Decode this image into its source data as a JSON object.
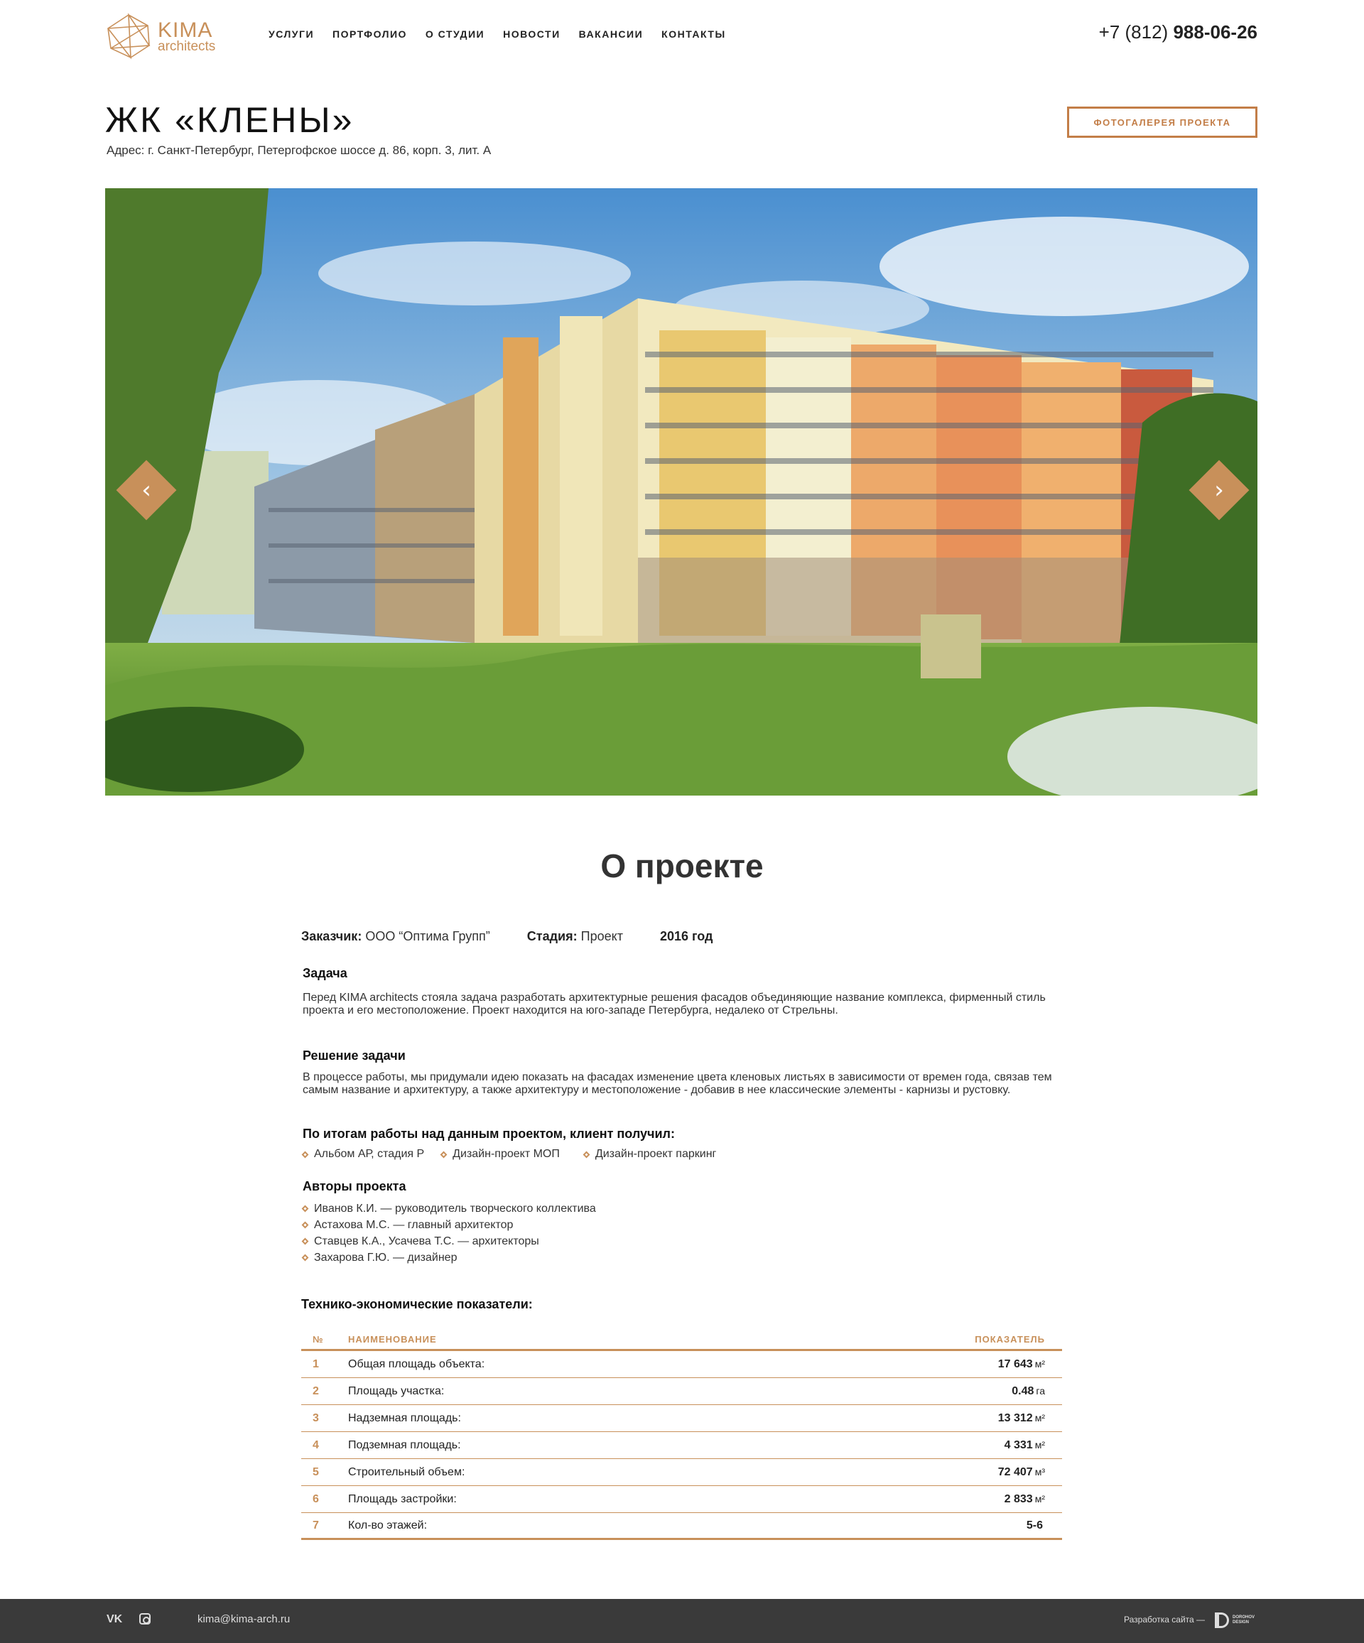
{
  "header": {
    "logo_title": "KIMA",
    "logo_sub": "architects",
    "nav": [
      "услуги",
      "портфолио",
      "о студии",
      "новости",
      "вакансии",
      "контакты"
    ],
    "phone_code": "+7 (812)",
    "phone_number": "988-06-26"
  },
  "project": {
    "title": "ЖК «КЛЕНЫ»",
    "address": "Адрес: г. Санкт-Петербург, Петергофское шоссе д. 86, корп. 3, лит. А",
    "gallery_button": "ФОТОГАЛЕРЕЯ ПРОЕКТА"
  },
  "slider": {
    "thumbs_count": 5,
    "active_thumb": 3
  },
  "about": {
    "title": "О проекте",
    "client_label": "Заказчик:",
    "client_value": "ООО “Оптима Групп”",
    "stage_label": "Стадия:",
    "stage_value": "Проект",
    "year": "2016 год",
    "task_head": "Задача",
    "task_text": "Перед KIMA architects стояла задача разработать архитектурные решения фасадов объединяющие название комплекса, фирменный стиль проекта и его местоположение. Проект находится на юго-западе Петербурга, недалеко от Стрельны.",
    "solution_head": "Решение задачи",
    "solution_text": "В процессе работы, мы придумали идею показать на фасадах изменение цвета кленовых листьях в зависимости от времен года, связав тем самым название и архитектуру, а также архитектуру и местоположение - добавив в нее классические элементы - карнизы и рустовку.",
    "result_head": "По итогам работы над данным проектом, клиент получил:",
    "results": [
      "Альбом АР, стадия Р",
      "Дизайн-проект МОП",
      "Дизайн-проект паркинг"
    ],
    "authors_head": "Авторы проекта",
    "authors": [
      "Иванов К.И. — руководитель творческого коллектива",
      "Астахова М.С. — главный архитектор",
      "Ставцев К.А., Усачева Т.С. — архитекторы",
      "Захарова Г.Ю. — дизайнер"
    ],
    "table_head": "Технико-экономические показатели:"
  },
  "table": {
    "col_num": "№",
    "col_name": "НАИМЕНОВАНИЕ",
    "col_value": "ПОКАЗАТЕЛЬ",
    "rows": [
      {
        "num": "1",
        "name": "Общая площадь объекта:",
        "value": "17 643",
        "unit": "м²"
      },
      {
        "num": "2",
        "name": "Площадь участка:",
        "value": "0.48",
        "unit": "га"
      },
      {
        "num": "3",
        "name": "Надземная площадь:",
        "value": "13 312",
        "unit": "м²"
      },
      {
        "num": "4",
        "name": "Подземная площадь:",
        "value": "4 331",
        "unit": "м²"
      },
      {
        "num": "5",
        "name": "Строительный объем:",
        "value": "72 407",
        "unit": "м³"
      },
      {
        "num": "6",
        "name": "Площадь застройки:",
        "value": "2 833",
        "unit": "м²"
      },
      {
        "num": "7",
        "name": "Кол-во этажей:",
        "value": "5-6",
        "unit": ""
      }
    ]
  },
  "footer": {
    "vk": "VK",
    "email": "kima@kima-arch.ru",
    "dev_label": "Разработка сайта —",
    "dev_name_1": "DOROHOV",
    "dev_name_2": "DESIGN"
  },
  "colors": {
    "accent": "#c8905a",
    "footer_bg": "#3a3a3a"
  }
}
